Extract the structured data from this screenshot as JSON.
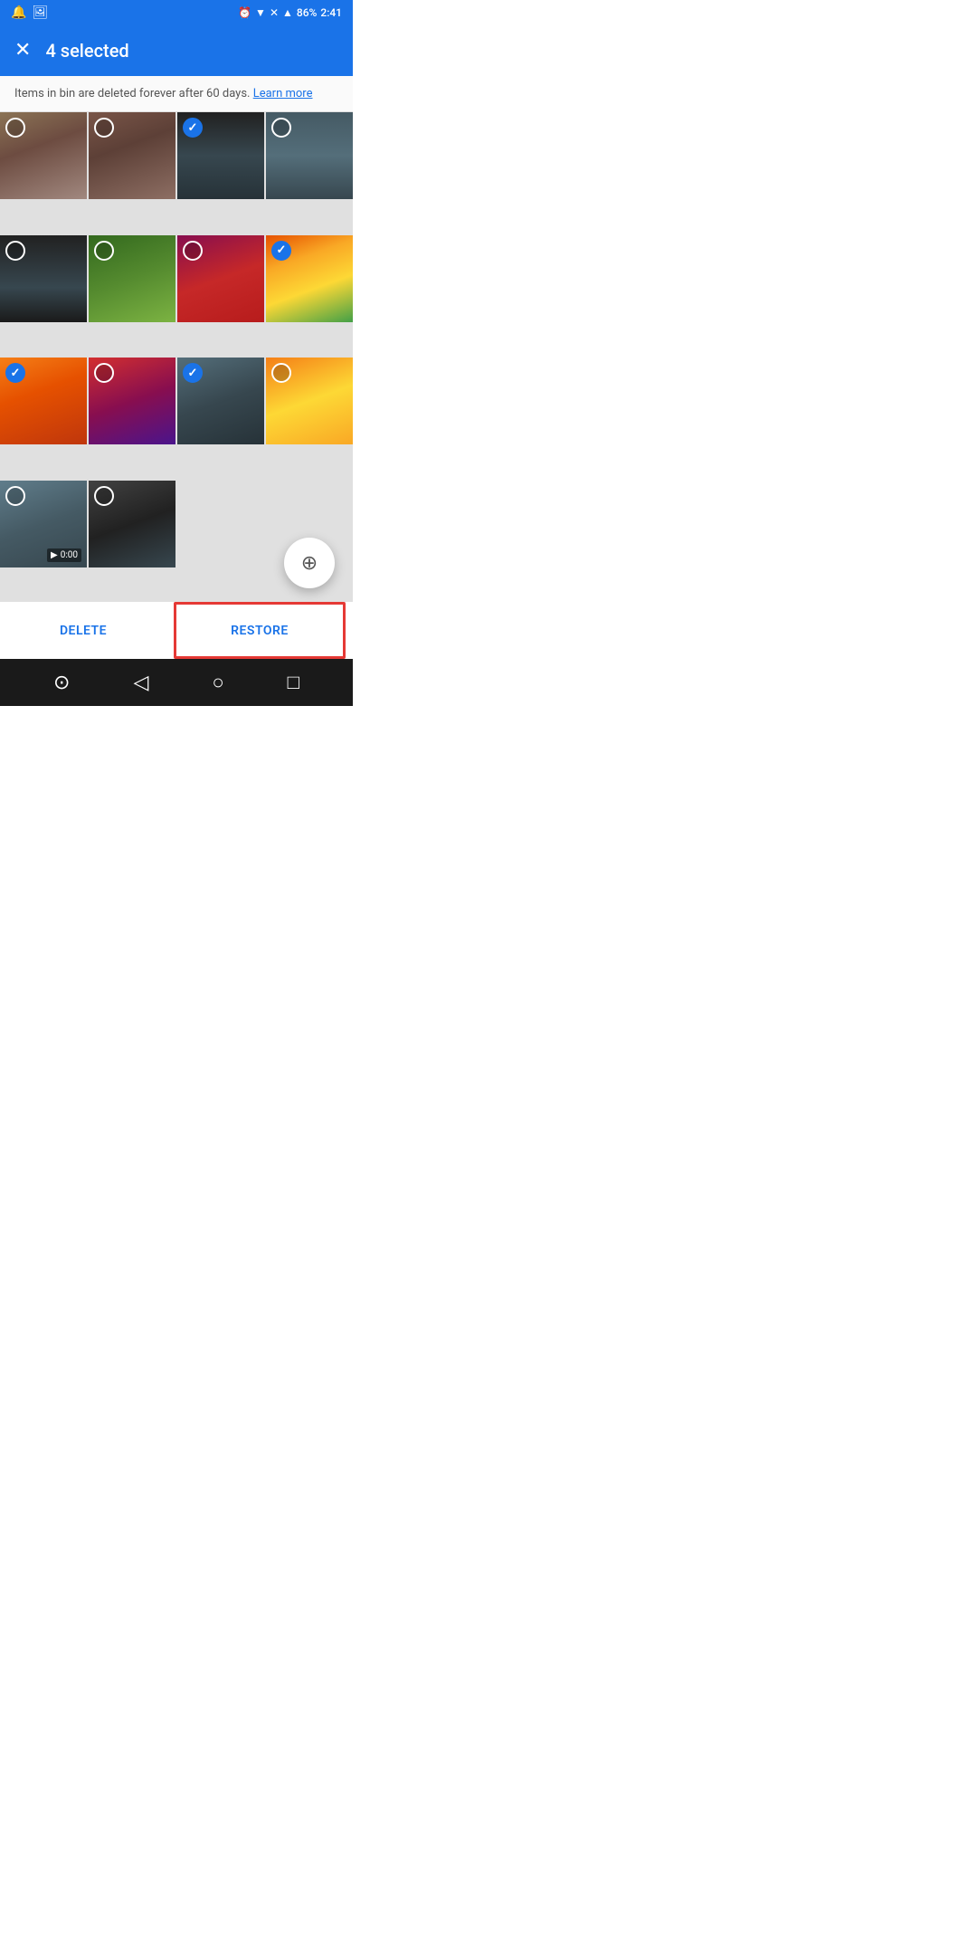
{
  "statusBar": {
    "time": "2:41",
    "battery": "86%",
    "icons": [
      "alarm",
      "wifi",
      "signal",
      "bars"
    ]
  },
  "appBar": {
    "title": "4 selected",
    "closeLabel": "✕"
  },
  "infoBanner": {
    "text": "Items in bin are deleted forever after 60 days.",
    "linkText": "Learn more"
  },
  "photos": [
    {
      "id": 1,
      "colorClass": "photo-1",
      "checked": false,
      "isVideo": false
    },
    {
      "id": 2,
      "colorClass": "photo-2",
      "checked": false,
      "isVideo": false
    },
    {
      "id": 3,
      "colorClass": "photo-3",
      "checked": true,
      "isVideo": false
    },
    {
      "id": 4,
      "colorClass": "photo-4",
      "checked": false,
      "isVideo": false
    },
    {
      "id": 5,
      "colorClass": "photo-5",
      "checked": false,
      "isVideo": false
    },
    {
      "id": 6,
      "colorClass": "photo-6",
      "checked": false,
      "isVideo": false
    },
    {
      "id": 7,
      "colorClass": "photo-7",
      "checked": false,
      "isVideo": false
    },
    {
      "id": 8,
      "colorClass": "photo-8",
      "checked": true,
      "isVideo": false
    },
    {
      "id": 9,
      "colorClass": "photo-9",
      "checked": true,
      "isVideo": false
    },
    {
      "id": 10,
      "colorClass": "photo-10",
      "checked": false,
      "isVideo": false
    },
    {
      "id": 11,
      "colorClass": "photo-11",
      "checked": true,
      "isVideo": false
    },
    {
      "id": 12,
      "colorClass": "photo-12",
      "checked": false,
      "isVideo": false
    },
    {
      "id": 13,
      "colorClass": "photo-13",
      "checked": false,
      "isVideo": true,
      "videoDuration": "0:00"
    },
    {
      "id": 14,
      "colorClass": "photo-14",
      "checked": false,
      "isVideo": false
    }
  ],
  "fab": {
    "icon": "⊕",
    "label": "zoom"
  },
  "actionBar": {
    "deleteLabel": "DELETE",
    "restoreLabel": "RESTORE"
  },
  "navBar": {
    "icons": [
      "⊙",
      "◁",
      "○",
      "□"
    ]
  }
}
